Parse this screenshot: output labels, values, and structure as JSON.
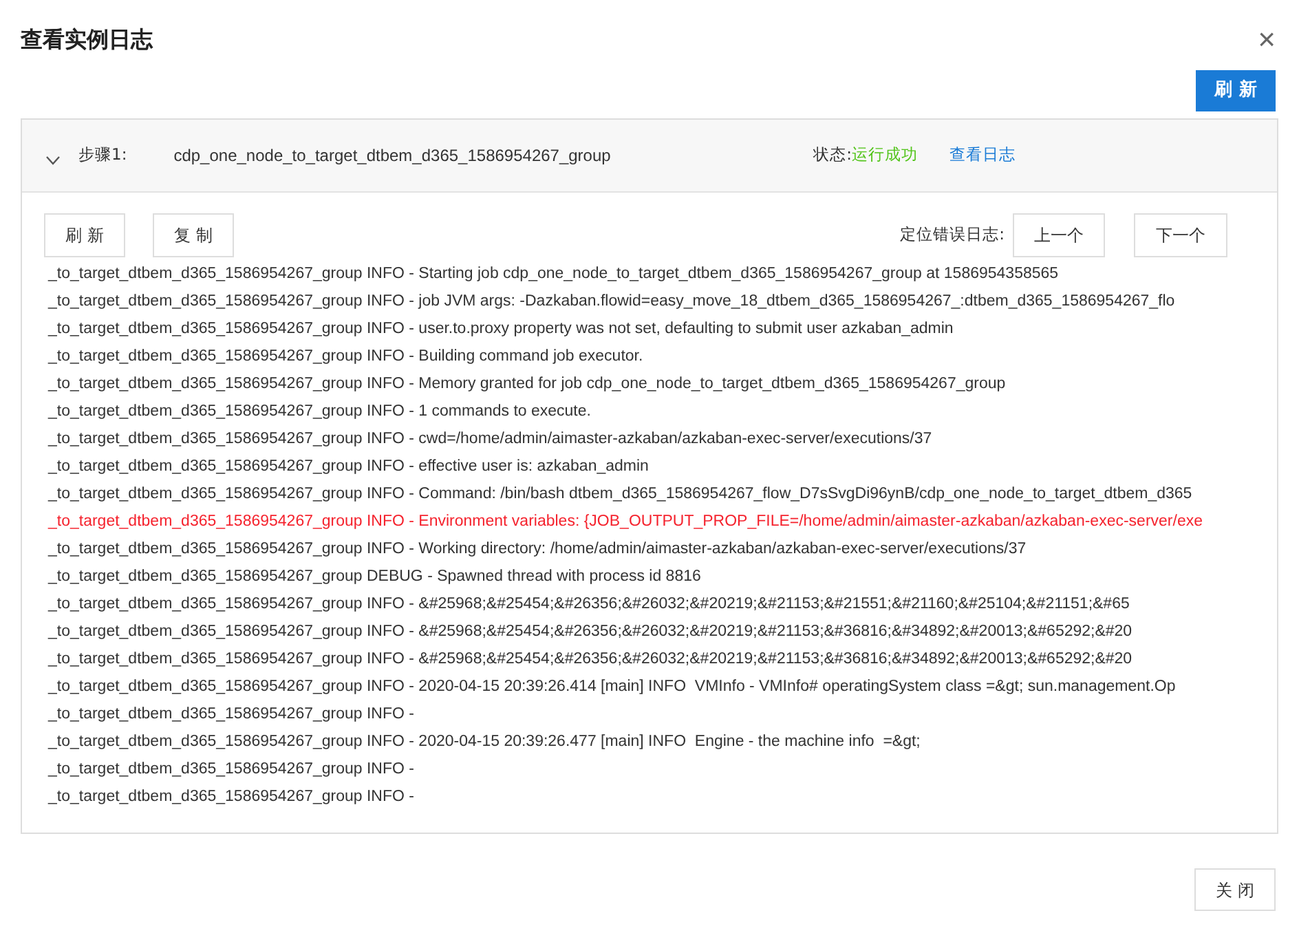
{
  "dialog": {
    "title": "查看实例日志",
    "close_icon": "×"
  },
  "toolbar": {
    "refresh_button": "刷 新"
  },
  "step": {
    "expanded": true,
    "label": "步骤1:",
    "name": "cdp_one_node_to_target_dtbem_d365_1586954267_group",
    "status_label": "状态:",
    "status": "运行成功",
    "view_log_link": "查看日志"
  },
  "log_toolbar": {
    "buttons": [
      "刷 新",
      "复 制"
    ],
    "locate_label": "定位错误日志:",
    "prev_button": "上一个",
    "next_button": "下一个"
  },
  "log_lines": [
    {
      "text": "_to_target_dtbem_d365_1586954267_group INFO - Starting job cdp_one_node_to_target_dtbem_d365_1586954267_group at 1586954358565",
      "error": false
    },
    {
      "text": "_to_target_dtbem_d365_1586954267_group INFO - job JVM args: -Dazkaban.flowid=easy_move_18_dtbem_d365_1586954267_:dtbem_d365_1586954267_flo",
      "error": false
    },
    {
      "text": "_to_target_dtbem_d365_1586954267_group INFO - user.to.proxy property was not set, defaulting to submit user azkaban_admin",
      "error": false
    },
    {
      "text": "_to_target_dtbem_d365_1586954267_group INFO - Building command job executor.",
      "error": false
    },
    {
      "text": "_to_target_dtbem_d365_1586954267_group INFO - Memory granted for job cdp_one_node_to_target_dtbem_d365_1586954267_group",
      "error": false
    },
    {
      "text": "_to_target_dtbem_d365_1586954267_group INFO - 1 commands to execute.",
      "error": false
    },
    {
      "text": "_to_target_dtbem_d365_1586954267_group INFO - cwd=/home/admin/aimaster-azkaban/azkaban-exec-server/executions/37",
      "error": false
    },
    {
      "text": "_to_target_dtbem_d365_1586954267_group INFO - effective user is: azkaban_admin",
      "error": false
    },
    {
      "text": "_to_target_dtbem_d365_1586954267_group INFO - Command: /bin/bash dtbem_d365_1586954267_flow_D7sSvgDi96ynB/cdp_one_node_to_target_dtbem_d365",
      "error": false
    },
    {
      "text": "_to_target_dtbem_d365_1586954267_group INFO - Environment variables: {JOB_OUTPUT_PROP_FILE=/home/admin/aimaster-azkaban/azkaban-exec-server/exe",
      "error": true
    },
    {
      "text": "_to_target_dtbem_d365_1586954267_group INFO - Working directory: /home/admin/aimaster-azkaban/azkaban-exec-server/executions/37",
      "error": false
    },
    {
      "text": "_to_target_dtbem_d365_1586954267_group DEBUG - Spawned thread with process id 8816",
      "error": false
    },
    {
      "text": "_to_target_dtbem_d365_1586954267_group INFO - &#25968;&#25454;&#26356;&#26032;&#20219;&#21153;&#21551;&#21160;&#25104;&#21151;&#65",
      "error": false
    },
    {
      "text": "_to_target_dtbem_d365_1586954267_group INFO - &#25968;&#25454;&#26356;&#26032;&#20219;&#21153;&#36816;&#34892;&#20013;&#65292;&#20",
      "error": false
    },
    {
      "text": "_to_target_dtbem_d365_1586954267_group INFO - &#25968;&#25454;&#26356;&#26032;&#20219;&#21153;&#36816;&#34892;&#20013;&#65292;&#20",
      "error": false
    },
    {
      "text": "_to_target_dtbem_d365_1586954267_group INFO - 2020-04-15 20:39:26.414 [main] INFO  VMInfo - VMInfo# operatingSystem class =&gt; sun.management.Op",
      "error": false
    },
    {
      "text": "_to_target_dtbem_d365_1586954267_group INFO -",
      "error": false
    },
    {
      "text": "_to_target_dtbem_d365_1586954267_group INFO - 2020-04-15 20:39:26.477 [main] INFO  Engine - the machine info  =&gt;",
      "error": false
    },
    {
      "text": "_to_target_dtbem_d365_1586954267_group INFO -",
      "error": false
    },
    {
      "text": "_to_target_dtbem_d365_1586954267_group INFO -",
      "error": false
    }
  ],
  "footer": {
    "close_button": "关 闭"
  }
}
